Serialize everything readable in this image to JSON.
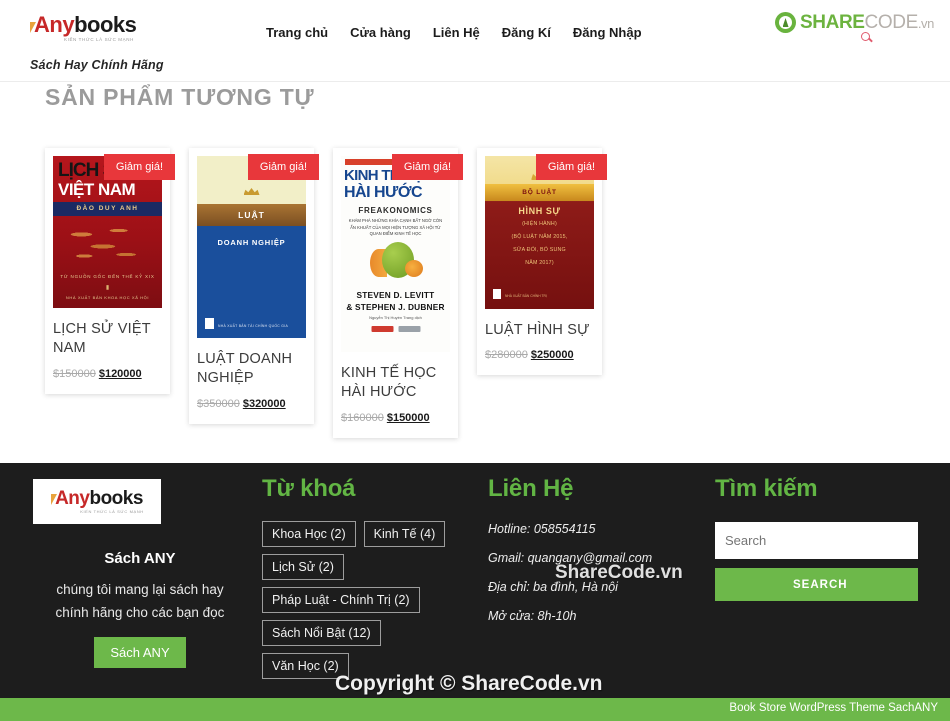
{
  "header": {
    "brand": {
      "tick_icon": "tick-icon",
      "name_red": "Any",
      "name_dark": "books",
      "subtext": "KIẾN THỨC LÀ SỨC MẠNH",
      "tagline": "Sách Hay Chính Hãng"
    },
    "nav": [
      {
        "label": "Trang chủ"
      },
      {
        "label": "Cửa hàng"
      },
      {
        "label": "Liên Hệ"
      },
      {
        "label": "Đăng Kí"
      },
      {
        "label": "Đăng Nhập"
      }
    ],
    "watermark_logo": {
      "share": "SHARE",
      "code": "CODE",
      "tld": ".vn"
    }
  },
  "related": {
    "title": "SẢN PHẨM TƯƠNG TỰ",
    "badge_label": "Giảm giá!",
    "products": [
      {
        "title": "LỊCH SỬ VIỆT NAM",
        "old_price": "$150000",
        "new_price": "$120000",
        "cover": {
          "line1": "LỊCH SỬ",
          "line2": "VIỆT NAM",
          "author": "ĐÀO DUY ANH",
          "foot1": "TỪ NGUỒN GỐC ĐẾN THẾ KỶ XIX",
          "foot2": "NHÀ XUẤT BẢN KHOA HỌC XÃ HỘI"
        }
      },
      {
        "title": "LUẬT DOANH NGHIỆP",
        "old_price": "$350000",
        "new_price": "$320000",
        "cover": {
          "line1": "LUẬT",
          "line2": "DOANH NGHIỆP",
          "publisher": "NHÀ XUẤT BẢN TÀI CHÍNH QUỐC GIA"
        }
      },
      {
        "title": "KINH TẾ HỌC HÀI HƯỚC",
        "old_price": "$160000",
        "new_price": "$150000",
        "cover": {
          "line1": "KINH TẾ HỌC",
          "line2": "HÀI HƯỚC",
          "line3": "FREAKONOMICS",
          "blurb": "KHÁM PHÁ NHỮNG KHÍA CẠNH BẤT NGỜ CÒN ẨN KHUẤT CỦA MỌI HIỆN TƯỢNG XÃ HỘI TỪ QUAN ĐIỂM KINH TẾ HỌC",
          "author1": "STEVEN D. LEVITT",
          "author2": "& STEPHEN J. DUBNER",
          "translator": "Nguyễn Thị Huyền Trang dịch"
        }
      },
      {
        "title": "LUẬT HÌNH SỰ",
        "old_price": "$280000",
        "new_price": "$250000",
        "cover": {
          "ribbon": "BỘ LUẬT",
          "line1": "HÌNH SỰ",
          "lines": [
            "(HIỆN HÀNH)",
            "(BỘ LUẬT NĂM 2015,",
            "SỬA ĐỔI, BỔ SUNG",
            "NĂM 2017)"
          ],
          "publisher": "NHÀ XUẤT BẢN CHÍNH TRỊ"
        }
      }
    ]
  },
  "footer": {
    "brand": {
      "name_red": "Any",
      "name_dark": "books",
      "subtext": "KIẾN THỨC LÀ SỨC MẠNH"
    },
    "about": {
      "heading": "Sách ANY",
      "line1": "chúng tôi mang lại sách hay",
      "line2": "chính hãng cho các bạn đọc",
      "button": "Sách ANY"
    },
    "tags_heading": "Từ khoá",
    "tags": [
      {
        "label": "Khoa Học (2)"
      },
      {
        "label": "Kinh Tế (4)"
      },
      {
        "label": "Lịch Sử (2)"
      },
      {
        "label": "Pháp Luật - Chính Trị (2)"
      },
      {
        "label": "Sách Nổi Bật (12)"
      },
      {
        "label": "Văn Học (2)"
      }
    ],
    "contact_heading": "Liên Hệ",
    "contact": [
      {
        "label": "Hotline: 058554115"
      },
      {
        "label": "Gmail: quangany@gmail.com"
      },
      {
        "label": "Địa chỉ: ba đình, Hà nội"
      },
      {
        "label": "Mở cửa: 8h-10h"
      }
    ],
    "search_heading": "Tìm kiếm",
    "search_placeholder": "Search",
    "search_value": "",
    "search_button": "SEARCH",
    "bottom_credit": "Book Store WordPress Theme SachANY"
  },
  "watermarks": {
    "middle": "ShareCode.vn",
    "bottom": "Copyright © ShareCode.vn"
  },
  "colors": {
    "green": "#6db84a",
    "heading_green": "#62b544",
    "badge_red": "#e8373b",
    "footer_bg": "#1d1d1d",
    "brand_red": "#c62828"
  }
}
